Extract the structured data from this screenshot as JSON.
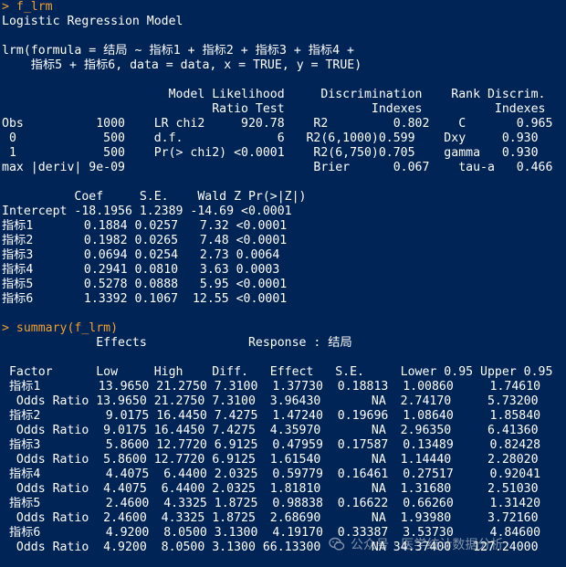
{
  "console": {
    "lines": [
      {
        "text": "> f_lrm",
        "kind": "cmd"
      },
      {
        "text": "Logistic Regression Model",
        "kind": "out"
      },
      {
        "text": "",
        "kind": "out"
      },
      {
        "text": "lrm(formula = 结局 ~ 指标1 + 指标2 + 指标3 + 指标4 +",
        "kind": "out"
      },
      {
        "text": "    指标5 + 指标6, data = data, x = TRUE, y = TRUE)",
        "kind": "out"
      },
      {
        "text": "",
        "kind": "out"
      },
      {
        "text": "                       Model Likelihood     Discrimination    Rank Discrim.",
        "kind": "out"
      },
      {
        "text": "                             Ratio Test            Indexes          Indexes",
        "kind": "out"
      },
      {
        "text": "Obs          1000    LR chi2     920.78    R2         0.802    C       0.965",
        "kind": "out"
      },
      {
        "text": " 0            500    d.f.             6   R2(6,1000)0.599    Dxy     0.930",
        "kind": "out"
      },
      {
        "text": " 1            500    Pr(> chi2) <0.0001    R2(6,750)0.705    gamma   0.930",
        "kind": "out"
      },
      {
        "text": "max |deriv| 9e-09                          Brier      0.067    tau-a   0.466",
        "kind": "out"
      },
      {
        "text": "",
        "kind": "out"
      },
      {
        "text": "          Coef     S.E.    Wald Z Pr(>|Z|)",
        "kind": "out"
      },
      {
        "text": "Intercept -18.1956 1.2389 -14.69 <0.0001",
        "kind": "out"
      },
      {
        "text": "指标1       0.1884 0.0257   7.32 <0.0001",
        "kind": "out"
      },
      {
        "text": "指标2       0.1982 0.0265   7.48 <0.0001",
        "kind": "out"
      },
      {
        "text": "指标3       0.0694 0.0254   2.73 0.0064",
        "kind": "out"
      },
      {
        "text": "指标4       0.2941 0.0810   3.63 0.0003",
        "kind": "out"
      },
      {
        "text": "指标5       0.5278 0.0888   5.95 <0.0001",
        "kind": "out"
      },
      {
        "text": "指标6       1.3392 0.1067  12.55 <0.0001",
        "kind": "out"
      },
      {
        "text": "",
        "kind": "out"
      },
      {
        "text": "> summary(f_lrm)",
        "kind": "cmd"
      },
      {
        "text": "             Effects              Response : 结局",
        "kind": "out"
      },
      {
        "text": "",
        "kind": "out"
      },
      {
        "text": " Factor      Low     High    Diff.   Effect   S.E.     Lower 0.95 Upper 0.95",
        "kind": "out"
      },
      {
        "text": " 指标1        13.9650 21.2750 7.3100  1.37730  0.18813  1.00860     1.74610",
        "kind": "out"
      },
      {
        "text": "  Odds Ratio 13.9650 21.2750 7.3100  3.96430       NA  2.74170     5.73200",
        "kind": "out"
      },
      {
        "text": " 指标2         9.0175 16.4450 7.4275  1.47240  0.19696  1.08640     1.85840",
        "kind": "out"
      },
      {
        "text": "  Odds Ratio  9.0175 16.4450 7.4275  4.35970       NA  2.96350     6.41360",
        "kind": "out"
      },
      {
        "text": " 指标3         5.8600 12.7720 6.9125  0.47959  0.17587  0.13489     0.82428",
        "kind": "out"
      },
      {
        "text": "  Odds Ratio  5.8600 12.7720 6.9125  1.61540       NA  1.14440     2.28020",
        "kind": "out"
      },
      {
        "text": " 指标4         4.4075  6.4400 2.0325  0.59779  0.16461  0.27517     0.92041",
        "kind": "out"
      },
      {
        "text": "  Odds Ratio  4.4075  6.4400 2.0325  1.81810       NA  1.31680     2.51030",
        "kind": "out"
      },
      {
        "text": " 指标5         2.4600  4.3325 1.8725  0.98838  0.16622  0.66260     1.31420",
        "kind": "out"
      },
      {
        "text": "  Odds Ratio  2.4600  4.3325 1.8725  2.68690       NA  1.93980     3.72160",
        "kind": "out"
      },
      {
        "text": " 指标6         4.9200  8.0500 3.1300  4.19170  0.33387  3.53730     4.84600",
        "kind": "out"
      },
      {
        "text": "  Odds Ratio  4.9200  8.0500 3.1300 66.13300       NA 34.37400   127.24000",
        "kind": "out"
      }
    ]
  },
  "watermark": {
    "icon": "wechat-icon",
    "text": "公众号 · 医学统计数据分析"
  },
  "colors": {
    "background": "#012456",
    "output_text": "#ffffff",
    "command_text": "#f0a030"
  }
}
